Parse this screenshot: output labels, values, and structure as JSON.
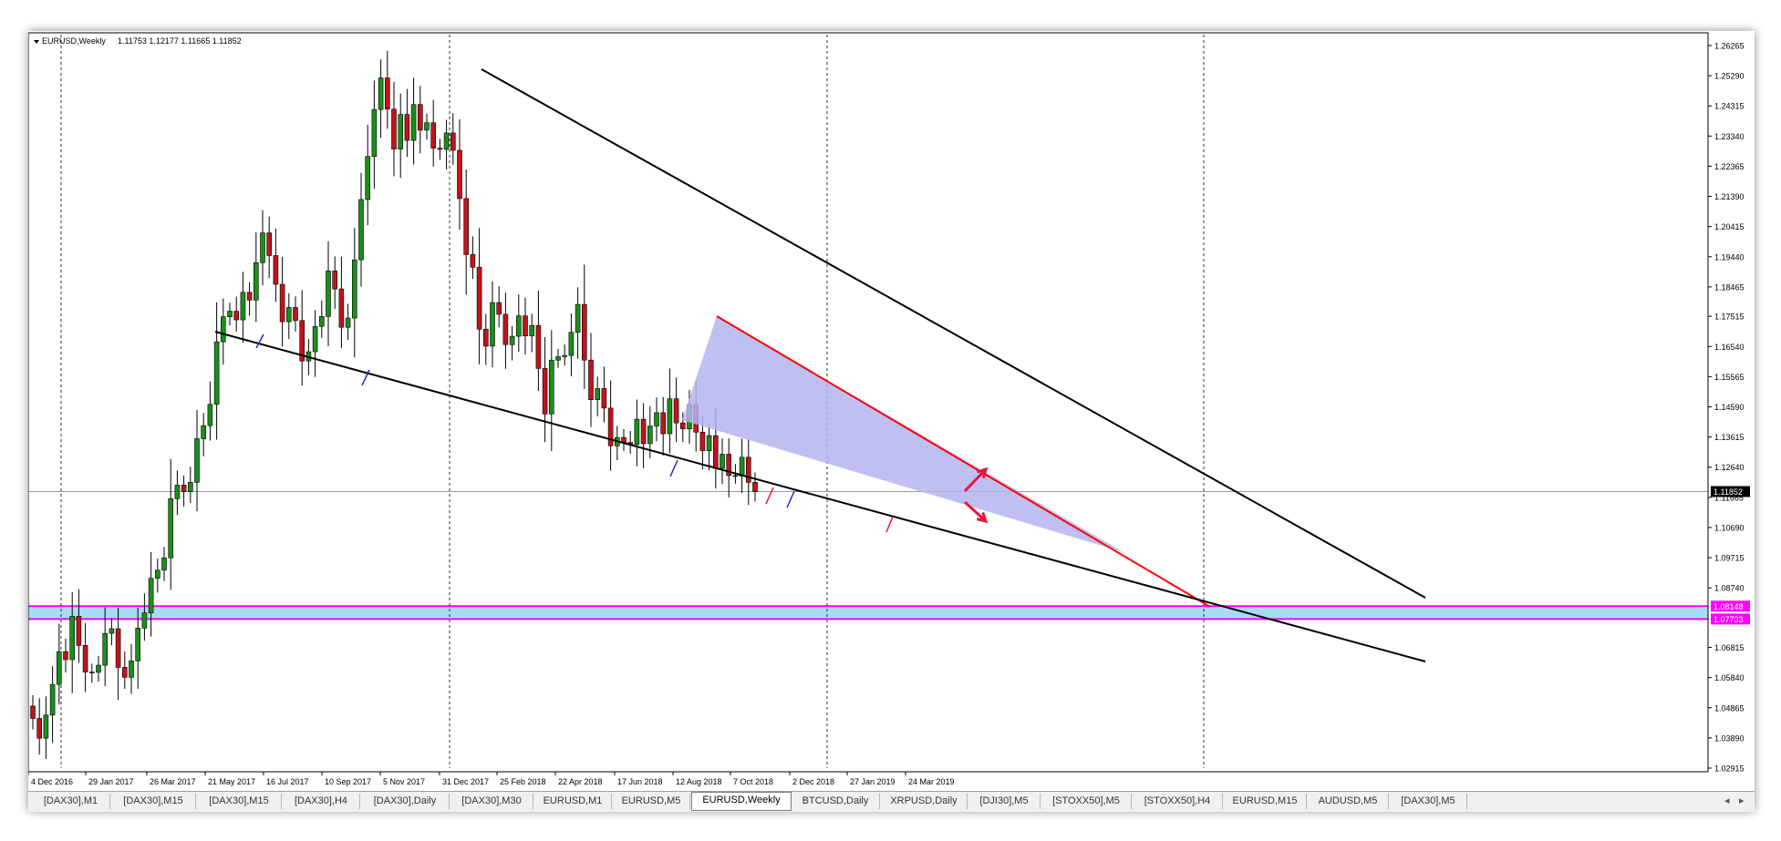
{
  "header": {
    "symbol_title": "EURUSD,Weekly",
    "ohlc": "1.11753 1.12177 1.11665 1.11852"
  },
  "colors": {
    "bull": "#1a8f1a",
    "bear": "#c0141c",
    "wick": "#000000",
    "trendline": "#000000",
    "wedge_line": "#ff0000",
    "wedge_fill": "#b4b4f0",
    "zone_fill": "#a6dcf4",
    "zone_border": "#ff00ff",
    "price_marker": "#000000",
    "arrows": "#e8143c"
  },
  "tabs": [
    {
      "label": "[DAX30],M1"
    },
    {
      "label": "[DAX30],M15"
    },
    {
      "label": "[DAX30],M15"
    },
    {
      "label": "[DAX30],H4"
    },
    {
      "label": "[DAX30],Daily"
    },
    {
      "label": "[DAX30],M30"
    },
    {
      "label": "EURUSD,M1"
    },
    {
      "label": "EURUSD,M5"
    },
    {
      "label": "EURUSD,Weekly",
      "active": true
    },
    {
      "label": "BTCUSD,Daily"
    },
    {
      "label": "XRPUSD,Daily"
    },
    {
      "label": "[DJI30],M5"
    },
    {
      "label": "[STOXX50],M5"
    },
    {
      "label": "[STOXX50],H4"
    },
    {
      "label": "EURUSD,M15"
    },
    {
      "label": "AUDUSD,M5"
    },
    {
      "label": "[DAX30],M5"
    }
  ],
  "nav": {
    "left": "◂",
    "right": "▸"
  },
  "chart_data": {
    "type": "candlestick",
    "title": "EURUSD,Weekly",
    "x_tick_labels": [
      "4 Dec 2016",
      "29 Jan 2017",
      "26 Mar 2017",
      "21 May 2017",
      "16 Jul 2017",
      "10 Sep 2017",
      "5 Nov 2017",
      "31 Dec 2017",
      "25 Feb 2018",
      "22 Apr 2018",
      "17 Jun 2018",
      "12 Aug 2018",
      "7 Oct 2018",
      "2 Dec 2018",
      "27 Jan 2019",
      "24 Mar 2019"
    ],
    "y_tick_labels": [
      "1.26265",
      "1.25290",
      "1.24315",
      "1.23340",
      "1.22365",
      "1.21390",
      "1.20415",
      "1.19440",
      "1.18465",
      "1.17515",
      "1.16540",
      "1.15565",
      "1.14590",
      "1.13615",
      "1.12640",
      "1.11665",
      "1.10690",
      "1.09715",
      "1.08740",
      "1.06815",
      "1.05840",
      "1.04865",
      "1.03890",
      "1.02915"
    ],
    "ylim": [
      1.02915,
      1.26265
    ],
    "current_price": "1.11852",
    "zone": {
      "top": "1.08148",
      "bottom": "1.07733"
    },
    "weekly_closes": [
      1.0452,
      1.0388,
      1.0463,
      1.0562,
      1.0668,
      1.0642,
      1.0782,
      1.0688,
      1.0602,
      1.0601,
      1.0624,
      1.0727,
      1.0742,
      1.0617,
      1.0585,
      1.0638,
      1.0744,
      1.0793,
      1.0905,
      1.0931,
      1.0971,
      1.1162,
      1.1206,
      1.1185,
      1.1215,
      1.1356,
      1.1398,
      1.1467,
      1.1669,
      1.175,
      1.1768,
      1.174,
      1.1829,
      1.1804,
      1.1925,
      1.2021,
      1.1948,
      1.1855,
      1.1734,
      1.178,
      1.1738,
      1.1607,
      1.1637,
      1.1719,
      1.1751,
      1.1898,
      1.184,
      1.1716,
      1.1746,
      1.1934,
      1.2129,
      1.2268,
      1.242,
      1.2522,
      1.2421,
      1.2292,
      1.2404,
      1.232,
      1.2436,
      1.2353,
      1.2377,
      1.2295,
      1.2291,
      1.2344,
      1.2288,
      1.2132,
      1.1951,
      1.191,
      1.171,
      1.1655,
      1.1796,
      1.1758,
      1.166,
      1.1687,
      1.1753,
      1.1688,
      1.1722,
      1.1583,
      1.1436,
      1.161,
      1.1621,
      1.1625,
      1.17,
      1.179,
      1.161,
      1.1482,
      1.1518,
      1.1455,
      1.1333,
      1.136,
      1.1344,
      1.1337,
      1.1419,
      1.134,
      1.1397,
      1.144,
      1.1372,
      1.1485,
      1.1407,
      1.1388,
      1.1466,
      1.1377,
      1.1317,
      1.1366,
      1.126,
      1.1306,
      1.1237,
      1.1235,
      1.1296,
      1.1215,
      1.1185
    ]
  }
}
